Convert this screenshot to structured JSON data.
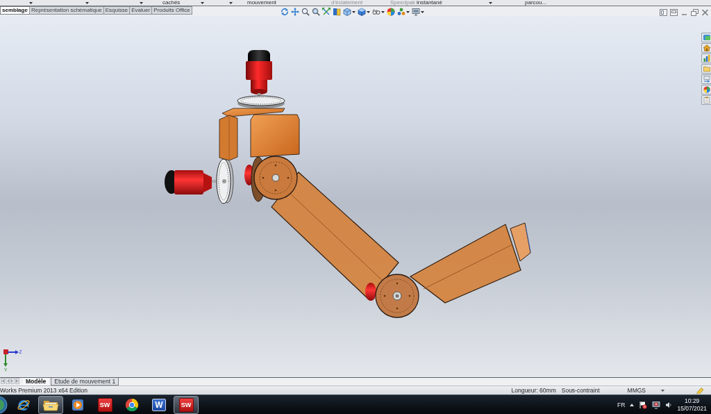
{
  "ribbon_labels": [
    {
      "text": "cachés",
      "disabled": false
    },
    {
      "text": "mouvement",
      "disabled": false
    },
    {
      "text": "d'éclatement",
      "disabled": true
    },
    {
      "text": "Speedpak",
      "disabled": true
    },
    {
      "text": "instantané",
      "disabled": false
    },
    {
      "text": "parcou...",
      "disabled": false
    }
  ],
  "command_tabs": [
    {
      "label": "semblage",
      "selected": true
    },
    {
      "label": "Représentation schématique",
      "selected": false
    },
    {
      "label": "Esquisse",
      "selected": false
    },
    {
      "label": "Evaluer",
      "selected": false
    },
    {
      "label": "Produits Office",
      "selected": false
    }
  ],
  "triad": {
    "z_label": "Z",
    "y_label": "Y"
  },
  "model_tabs": [
    {
      "label": "Modèle",
      "selected": true
    },
    {
      "label": "Etude de mouvement 1",
      "selected": false
    }
  ],
  "status_bar": {
    "product": "Works Premium 2013 x64 Edition",
    "length": "Longueur: 60mm",
    "constraint": "Sous-contraint",
    "units": "MMGS"
  },
  "taskbar": {
    "apps": [
      {
        "kind": "browser",
        "active": false
      },
      {
        "kind": "explorer",
        "active": true
      },
      {
        "kind": "media",
        "active": false
      },
      {
        "kind": "cad",
        "label": "SW",
        "active": false
      },
      {
        "kind": "chrome",
        "active": false
      },
      {
        "kind": "word",
        "label": "W",
        "active": false
      },
      {
        "kind": "cad",
        "label": "SW",
        "active": true
      }
    ],
    "language": "FR",
    "time": "10:29",
    "date": "15/07/2021"
  }
}
